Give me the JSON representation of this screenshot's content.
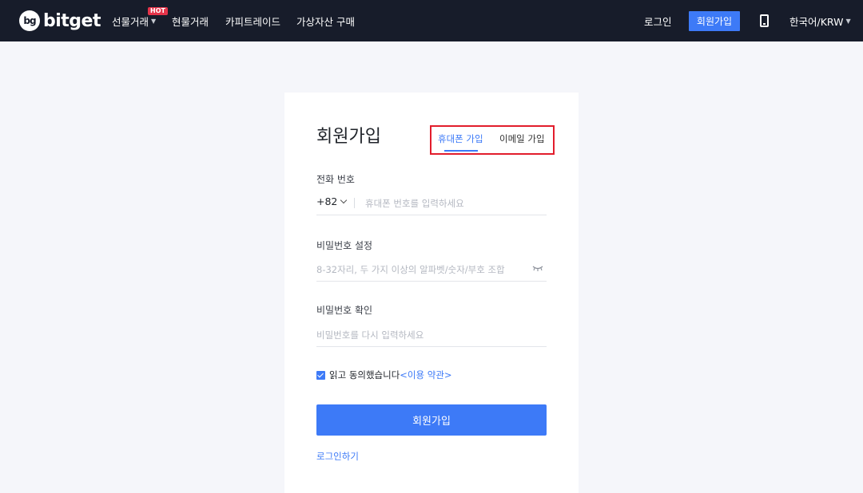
{
  "colors": {
    "nav_bg": "#171c2a",
    "accent": "#3d7af7",
    "hot_badge": "#e5344a",
    "highlight_box": "#e21d2c"
  },
  "header": {
    "logo_text": "bitget",
    "logo_mark": "bg",
    "nav": {
      "futures": "선물거래",
      "hot_badge": "HOT",
      "spot": "현물거래",
      "copy_trade": "카피트레이드",
      "buy_crypto": "가상자산 구매"
    },
    "login": "로그인",
    "signup": "회원가입",
    "language": "한국어/KRW"
  },
  "form": {
    "title": "회원가입",
    "tabs": {
      "phone": "휴대폰 가입",
      "email": "이메일 가입"
    },
    "phone": {
      "label": "전화 번호",
      "country_code": "+82",
      "placeholder": "휴대폰 번호를 입력하세요"
    },
    "password": {
      "label": "비밀번호 설정",
      "placeholder": "8-32자리, 두 가지 이상의 알파벳/숫자/부호 조합"
    },
    "confirm": {
      "label": "비밀번호 확인",
      "placeholder": "비밀번호를 다시 입력하세요"
    },
    "agree_text": "읽고 동의했습니다",
    "terms_link": "<이용 약관>",
    "agreed": true,
    "submit": "회원가입",
    "login_link": "로그인하기"
  }
}
